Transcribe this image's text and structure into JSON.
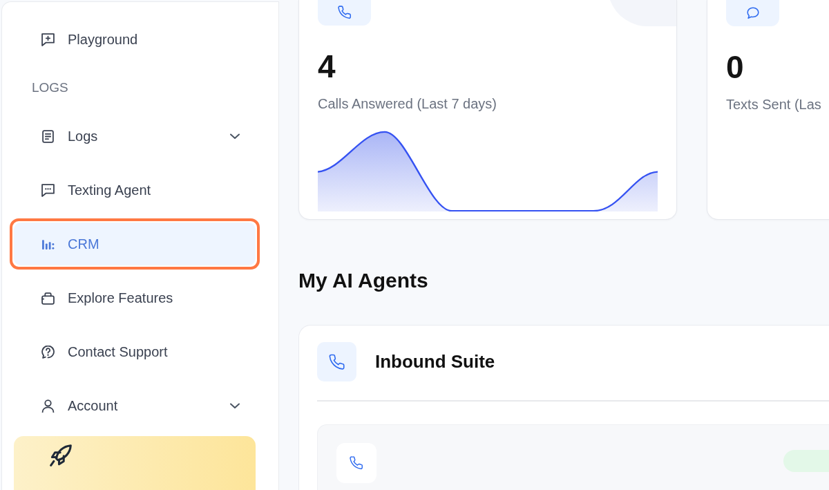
{
  "sidebar": {
    "items": [
      {
        "kind": "link",
        "label": "Playground",
        "selected": false,
        "highlighted": false
      },
      {
        "kind": "section",
        "label": "LOGS"
      },
      {
        "kind": "group",
        "label": "Logs",
        "selected": false,
        "expanded": false,
        "highlighted": false
      },
      {
        "kind": "link",
        "label": "Texting Agent",
        "selected": false,
        "highlighted": false
      },
      {
        "kind": "link",
        "label": "CRM",
        "selected": true,
        "highlighted": true
      },
      {
        "kind": "link",
        "label": "Explore Features",
        "selected": false,
        "highlighted": false
      },
      {
        "kind": "link",
        "label": "Contact Support",
        "selected": false,
        "highlighted": false
      },
      {
        "kind": "group",
        "label": "Account",
        "selected": false,
        "expanded": false,
        "highlighted": false
      },
      {
        "kind": "promo"
      }
    ]
  },
  "stats": [
    {
      "kind": "calls",
      "value": "4",
      "label": "Calls Answered (Last 7 days)",
      "trend": true
    },
    {
      "kind": "texts",
      "value": "0",
      "label": "Texts Sent (Las",
      "trend": false
    }
  ],
  "agents_heading": "My AI Agents",
  "agents": [
    {
      "kind": "calls",
      "title": "Inbound Suite"
    }
  ]
}
